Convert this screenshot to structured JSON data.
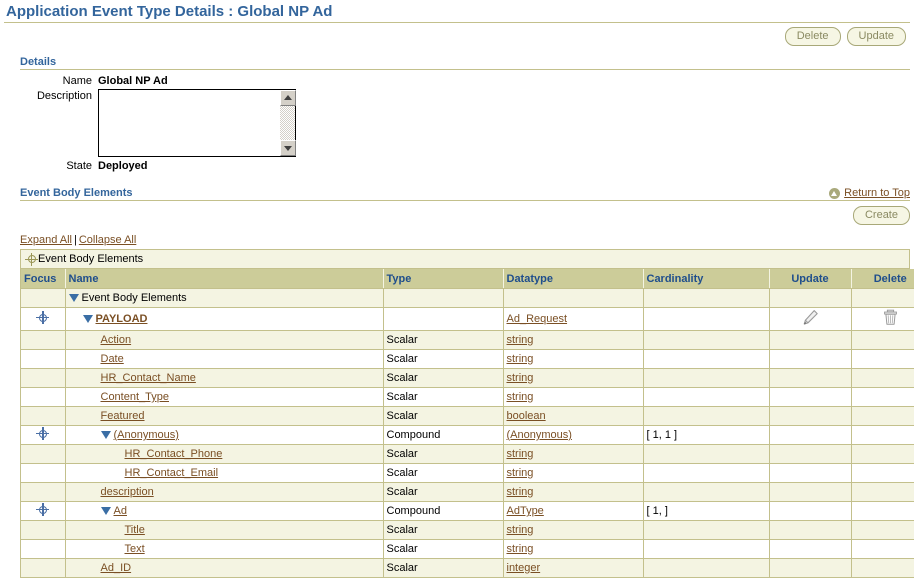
{
  "page": {
    "title": "Application Event Type Details : Global NP Ad"
  },
  "top_actions": {
    "delete_label": "Delete",
    "update_label": "Update"
  },
  "details": {
    "heading": "Details",
    "name_label": "Name",
    "name_value": "Global NP Ad",
    "description_label": "Description",
    "description_value": "",
    "state_label": "State",
    "state_value": "Deployed"
  },
  "event_body": {
    "heading": "Event Body Elements",
    "return_to_top": "Return to Top",
    "create_label": "Create",
    "expand_all": "Expand All",
    "collapse_all": "Collapse All",
    "separator": "|",
    "locator_label": "Event Body Elements"
  },
  "table": {
    "columns": [
      "Focus",
      "Name",
      "Type",
      "Datatype",
      "Cardinality",
      "Update",
      "Delete"
    ],
    "rows": [
      {
        "focus": false,
        "indent": 0,
        "expander": true,
        "name": "Event Body Elements",
        "name_is_link": false,
        "name_bold": false,
        "type": "",
        "datatype": "",
        "cardinality": "",
        "update": false,
        "delete": false,
        "band": true
      },
      {
        "focus": true,
        "indent": 1,
        "expander": true,
        "name": "PAYLOAD",
        "name_is_link": true,
        "name_bold": true,
        "type": "",
        "datatype": "Ad_Request",
        "cardinality": "",
        "update": true,
        "delete": true,
        "band": false
      },
      {
        "focus": false,
        "indent": 2,
        "expander": false,
        "name": "Action",
        "name_is_link": true,
        "name_bold": false,
        "type": "Scalar",
        "datatype": "string",
        "cardinality": "",
        "update": false,
        "delete": false,
        "band": true
      },
      {
        "focus": false,
        "indent": 2,
        "expander": false,
        "name": "Date",
        "name_is_link": true,
        "name_bold": false,
        "type": "Scalar",
        "datatype": "string",
        "cardinality": "",
        "update": false,
        "delete": false,
        "band": false
      },
      {
        "focus": false,
        "indent": 2,
        "expander": false,
        "name": "HR_Contact_Name",
        "name_is_link": true,
        "name_bold": false,
        "type": "Scalar",
        "datatype": "string",
        "cardinality": "",
        "update": false,
        "delete": false,
        "band": true
      },
      {
        "focus": false,
        "indent": 2,
        "expander": false,
        "name": "Content_Type",
        "name_is_link": true,
        "name_bold": false,
        "type": "Scalar",
        "datatype": "string",
        "cardinality": "",
        "update": false,
        "delete": false,
        "band": false
      },
      {
        "focus": false,
        "indent": 2,
        "expander": false,
        "name": "Featured",
        "name_is_link": true,
        "name_bold": false,
        "type": "Scalar",
        "datatype": "boolean",
        "cardinality": "",
        "update": false,
        "delete": false,
        "band": true
      },
      {
        "focus": true,
        "indent": 2,
        "expander": true,
        "name": "(Anonymous)",
        "name_is_link": true,
        "name_bold": false,
        "type": "Compound",
        "datatype": "(Anonymous)",
        "cardinality": "[ 1, 1 ]",
        "update": false,
        "delete": false,
        "band": false
      },
      {
        "focus": false,
        "indent": 3,
        "expander": false,
        "name": "HR_Contact_Phone",
        "name_is_link": true,
        "name_bold": false,
        "type": "Scalar",
        "datatype": "string",
        "cardinality": "",
        "update": false,
        "delete": false,
        "band": true
      },
      {
        "focus": false,
        "indent": 3,
        "expander": false,
        "name": "HR_Contact_Email",
        "name_is_link": true,
        "name_bold": false,
        "type": "Scalar",
        "datatype": "string",
        "cardinality": "",
        "update": false,
        "delete": false,
        "band": false
      },
      {
        "focus": false,
        "indent": 2,
        "expander": false,
        "name": "description",
        "name_is_link": true,
        "name_bold": false,
        "type": "Scalar",
        "datatype": "string",
        "cardinality": "",
        "update": false,
        "delete": false,
        "band": true
      },
      {
        "focus": true,
        "indent": 2,
        "expander": true,
        "name": "Ad",
        "name_is_link": true,
        "name_bold": false,
        "type": "Compound",
        "datatype": "AdType",
        "cardinality": "[ 1, ]",
        "update": false,
        "delete": false,
        "band": false
      },
      {
        "focus": false,
        "indent": 3,
        "expander": false,
        "name": "Title",
        "name_is_link": true,
        "name_bold": false,
        "type": "Scalar",
        "datatype": "string",
        "cardinality": "",
        "update": false,
        "delete": false,
        "band": true
      },
      {
        "focus": false,
        "indent": 3,
        "expander": false,
        "name": "Text",
        "name_is_link": true,
        "name_bold": false,
        "type": "Scalar",
        "datatype": "string",
        "cardinality": "",
        "update": false,
        "delete": false,
        "band": false
      },
      {
        "focus": false,
        "indent": 2,
        "expander": false,
        "name": "Ad_ID",
        "name_is_link": true,
        "name_bold": false,
        "type": "Scalar",
        "datatype": "integer",
        "cardinality": "",
        "update": false,
        "delete": false,
        "band": true
      }
    ]
  },
  "colors": {
    "title_blue": "#33659c",
    "header_tan": "#cccc99",
    "band": "#f4f4e2",
    "link_brown": "#7a4f24",
    "rule": "#c3c08c"
  }
}
